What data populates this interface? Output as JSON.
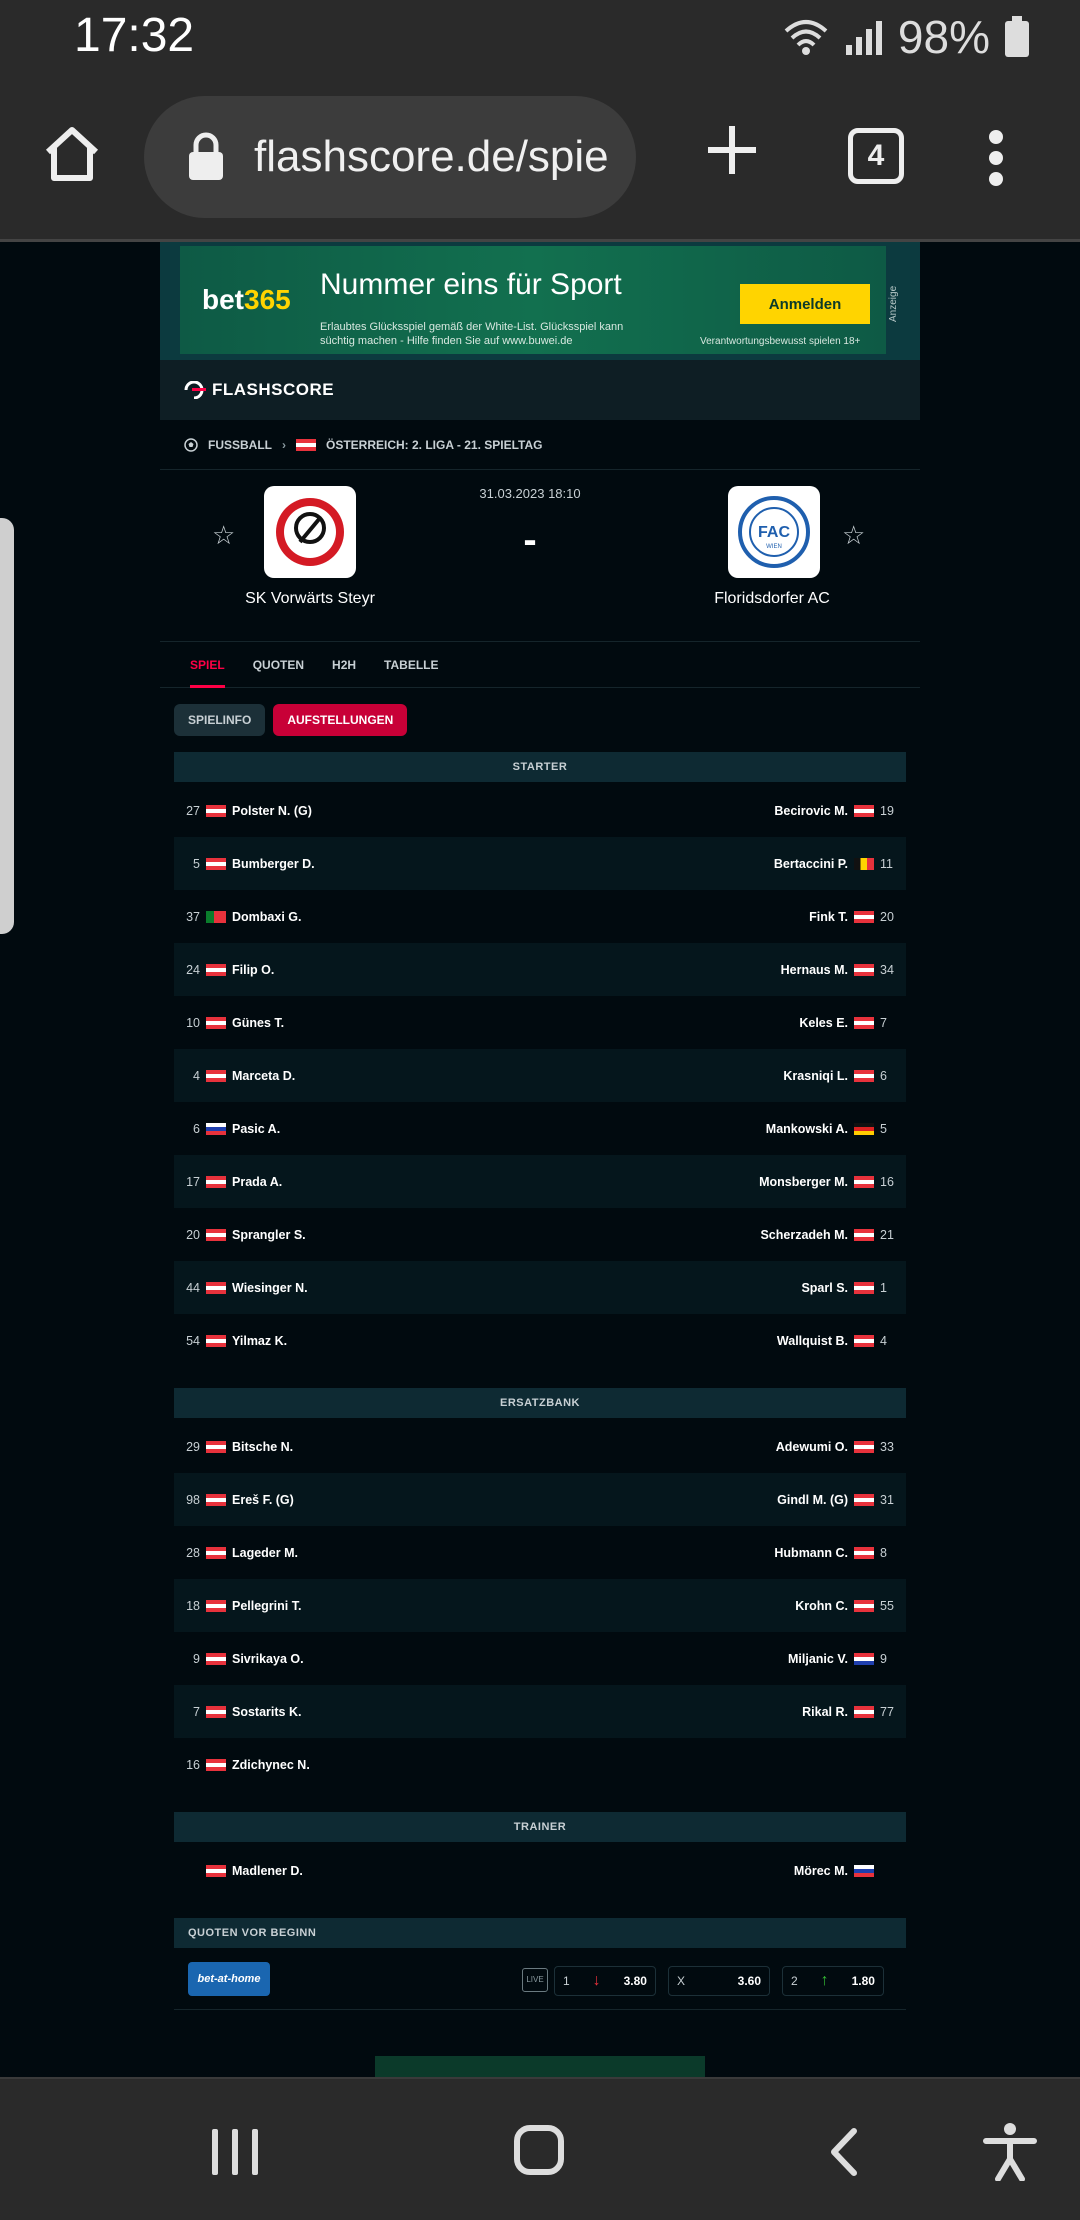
{
  "status": {
    "time": "17:32",
    "battery": "98%"
  },
  "browser": {
    "url": "flashscore.de/spie",
    "tab_count": "4"
  },
  "ad": {
    "brand_a": "bet",
    "brand_b": "365",
    "headline": "Nummer eins für Sport",
    "fineprint": "Erlaubtes Glücksspiel gemäß der White-List. Glücksspiel kann süchtig machen - Hilfe finden Sie auf www.buwei.de",
    "cta": "Anmelden",
    "responsible": "Verantwortungsbewusst spielen  18+",
    "marker": "Anzeige"
  },
  "site": {
    "logo": "FLASHSCORE"
  },
  "breadcrumb": {
    "sport": "FUSSBALL",
    "competition": "ÖSTERREICH: 2. LIGA - 21. SPIELTAG"
  },
  "match": {
    "datetime": "31.03.2023 18:10",
    "score": "-",
    "home": {
      "name": "SK Vorwärts Steyr"
    },
    "away": {
      "name": "Floridsdorfer AC",
      "badge": "FAC",
      "badge_sub": "WIEN"
    }
  },
  "tabs": [
    "SPIEL",
    "QUOTEN",
    "H2H",
    "TABELLE"
  ],
  "subtabs": [
    "SPIELINFO",
    "AUFSTELLUNGEN"
  ],
  "sections": {
    "starter": "STARTER",
    "bench": "ERSATZBANK",
    "trainer": "TRAINER",
    "odds": "QUOTEN VOR BEGINN"
  },
  "starters": [
    {
      "hn": "27",
      "hname": "Polster N. (G)",
      "hflag": "at",
      "aname": "Becirovic M.",
      "aflag": "at",
      "an": "19"
    },
    {
      "hn": "5",
      "hname": "Bumberger D.",
      "hflag": "at",
      "aname": "Bertaccini P.",
      "aflag": "be",
      "an": "11"
    },
    {
      "hn": "37",
      "hname": "Dombaxi G.",
      "hflag": "pt",
      "aname": "Fink T.",
      "aflag": "at",
      "an": "20"
    },
    {
      "hn": "24",
      "hname": "Filip O.",
      "hflag": "at",
      "aname": "Hernaus M.",
      "aflag": "at",
      "an": "34"
    },
    {
      "hn": "10",
      "hname": "Günes T.",
      "hflag": "at",
      "aname": "Keles E.",
      "aflag": "at",
      "an": "7"
    },
    {
      "hn": "4",
      "hname": "Marceta D.",
      "hflag": "at",
      "aname": "Krasniqi L.",
      "aflag": "at",
      "an": "6"
    },
    {
      "hn": "6",
      "hname": "Pasic A.",
      "hflag": "si",
      "aname": "Mankowski A.",
      "aflag": "de",
      "an": "5"
    },
    {
      "hn": "17",
      "hname": "Prada A.",
      "hflag": "at",
      "aname": "Monsberger M.",
      "aflag": "at",
      "an": "16"
    },
    {
      "hn": "20",
      "hname": "Sprangler S.",
      "hflag": "at",
      "aname": "Scherzadeh M.",
      "aflag": "at",
      "an": "21"
    },
    {
      "hn": "44",
      "hname": "Wiesinger N.",
      "hflag": "at",
      "aname": "Sparl S.",
      "aflag": "at",
      "an": "1"
    },
    {
      "hn": "54",
      "hname": "Yilmaz K.",
      "hflag": "at",
      "aname": "Wallquist B.",
      "aflag": "at",
      "an": "4"
    }
  ],
  "bench": [
    {
      "hn": "29",
      "hname": "Bitsche N.",
      "hflag": "at",
      "aname": "Adewumi O.",
      "aflag": "at",
      "an": "33"
    },
    {
      "hn": "98",
      "hname": "Ereš F. (G)",
      "hflag": "at",
      "aname": "Gindl M. (G)",
      "aflag": "at",
      "an": "31"
    },
    {
      "hn": "28",
      "hname": "Lageder M.",
      "hflag": "at",
      "aname": "Hubmann C.",
      "aflag": "at",
      "an": "8"
    },
    {
      "hn": "18",
      "hname": "Pellegrini T.",
      "hflag": "at",
      "aname": "Krohn C.",
      "aflag": "at",
      "an": "55"
    },
    {
      "hn": "9",
      "hname": "Sivrikaya O.",
      "hflag": "at",
      "aname": "Miljanic V.",
      "aflag": "hr",
      "an": "9"
    },
    {
      "hn": "7",
      "hname": "Sostarits K.",
      "hflag": "at",
      "aname": "Rikal R.",
      "aflag": "at",
      "an": "77"
    },
    {
      "hn": "16",
      "hname": "Zdichynec N.",
      "hflag": "at",
      "aname": "",
      "aflag": "",
      "an": ""
    }
  ],
  "trainers": {
    "home": "Madlener D.",
    "hflag": "at",
    "away": "Mörec M.",
    "aflag": "si"
  },
  "odds": {
    "bookmaker": "bet-at-home",
    "live": "LIVE",
    "o1_label": "1",
    "o1_value": "3.80",
    "ox_label": "X",
    "ox_value": "3.60",
    "o2_label": "2",
    "o2_value": "1.80"
  },
  "colors": {
    "accent": "#ff0046",
    "background": "#010a0f",
    "section": "#0e2a33"
  }
}
